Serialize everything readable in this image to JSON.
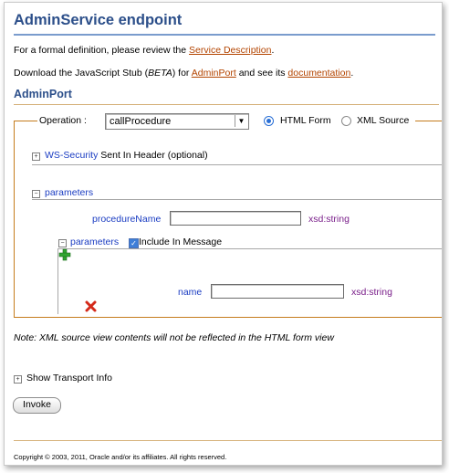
{
  "page": {
    "title": "AdminService endpoint",
    "definition_prefix": "For a formal definition, please review the",
    "definition_link": "Service Description",
    "definition_suffix": ".",
    "stub_prefix": "Download the JavaScript Stub (",
    "stub_beta": "BETA",
    "stub_for": ") for",
    "stub_link": "AdminPort",
    "stub_mid": "and see its",
    "stub_doc_link": "documentation",
    "stub_suffix": "."
  },
  "port": {
    "title": "AdminPort",
    "operation_label": "Operation :",
    "operation_value": "callProcedure",
    "radio_html": "HTML Form",
    "radio_xml": "XML Source",
    "html_selected": true
  },
  "security": {
    "expander": "+",
    "link": "WS-Security",
    "label": "Sent In Header (optional)"
  },
  "parameters": {
    "expander": "−",
    "label": "parameters",
    "procedure_name_label": "procedureName",
    "procedure_name_value": "",
    "procedure_name_type": "xsd:string",
    "nested_expander": "−",
    "nested_label": "parameters",
    "include_label": "Include In Message",
    "include_checked": "✓",
    "add_icon": "+",
    "remove_icon": "✖",
    "name_label": "name",
    "name_value": "",
    "name_type": "xsd:string"
  },
  "note": "Note: XML source view contents will not be reflected in the HTML form view",
  "transport": {
    "expander": "+",
    "label": "Show Transport Info"
  },
  "invoke_label": "Invoke",
  "footer": "Copyright © 2003, 2011, Oracle and/or its affiliates. All rights reserved.",
  "colors": {
    "title": "#2c4f8a",
    "link": "#b34400",
    "blue_label": "#1a3cc2",
    "type_label": "#7a1f8a",
    "add_icon": "#2fa52f",
    "remove_icon": "#d42a1a"
  }
}
